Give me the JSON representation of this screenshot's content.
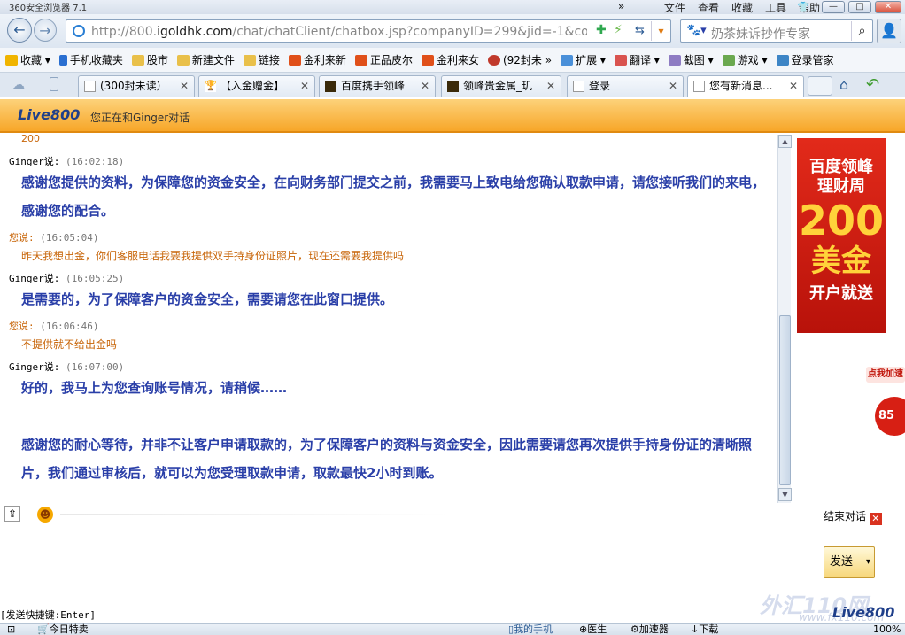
{
  "window": {
    "title": "360安全浏览器 7.1",
    "menu": [
      "文件",
      "查看",
      "收藏",
      "工具",
      "帮助"
    ],
    "controls": {
      "more": "»",
      "minimize": "—",
      "maximize": "□",
      "close": "✕"
    }
  },
  "nav": {
    "url_host": "http://800.",
    "url_domain": "igoldhk.com",
    "url_path": "/chat/chatClient/chatbox.jsp?companyID=299&jid=-1&configID",
    "search_placeholder": "奶茶妹诉抄作专家"
  },
  "favorites": [
    {
      "label": "收藏",
      "icon": "star-icon",
      "color": "#f0b400"
    },
    {
      "label": "手机收藏夹",
      "icon": "phone-icon",
      "color": "#2a6fd1"
    },
    {
      "label": "股市",
      "icon": "folder-icon",
      "color": "#e9c04a"
    },
    {
      "label": "新建文件",
      "icon": "folder-icon",
      "color": "#e9c04a"
    },
    {
      "label": "链接",
      "icon": "folder-icon",
      "color": "#e9c04a"
    },
    {
      "label": "金利来新",
      "icon": "taobao-icon",
      "color": "#e0501a"
    },
    {
      "label": "正品皮尔",
      "icon": "taobao-icon",
      "color": "#e0501a"
    },
    {
      "label": "金利来女",
      "icon": "taobao-icon",
      "color": "#e0501a"
    },
    {
      "label": "(92封未",
      "icon": "shop-icon",
      "color": "#c0392b"
    },
    {
      "label": "扩展",
      "icon": "extension-icon",
      "color": "#4a90d9"
    },
    {
      "label": "翻译",
      "icon": "translate-icon",
      "color": "#d9534f"
    },
    {
      "label": "截图",
      "icon": "screenshot-icon",
      "color": "#8e7cc3"
    },
    {
      "label": "游戏",
      "icon": "game-icon",
      "color": "#6aa84f"
    },
    {
      "label": "登录管家",
      "icon": "key-icon",
      "color": "#3d85c6"
    }
  ],
  "tabs": [
    {
      "label": "(300封未读）",
      "active": false
    },
    {
      "label": "【入金赠金】",
      "active": false
    },
    {
      "label": "百度携手领峰",
      "active": false
    },
    {
      "label": "领峰贵金属_玑",
      "active": false
    },
    {
      "label": "登录",
      "active": false
    },
    {
      "label": "您有新消息...",
      "active": true
    }
  ],
  "live800": {
    "logo": "Live800",
    "talking_with": "您正在和Ginger对话"
  },
  "chat": {
    "partial_top": "200",
    "messages": [
      {
        "speaker": "Ginger说:",
        "time": "(16:02:18)",
        "role": "agent",
        "text": "感谢您提供的资料，为保障您的资金安全，在向财务部门提交之前，我需要马上致电给您确认取款申请，请您接听我们的来电，感谢您的配合。"
      },
      {
        "speaker": "您说:",
        "time": "(16:05:04)",
        "role": "user",
        "text": "昨天我想出金，你们客服电话我要我提供双手持身份证照片，现在还需要我提供吗"
      },
      {
        "speaker": "Ginger说:",
        "time": "(16:05:25)",
        "role": "agent",
        "text": "是需要的，为了保障客户的资金安全，需要请您在此窗口提供。"
      },
      {
        "speaker": "您说:",
        "time": "(16:06:46)",
        "role": "user",
        "text": "不提供就不给出金吗"
      },
      {
        "speaker": "Ginger说:",
        "time": "(16:07:00)",
        "role": "agent",
        "text": "好的，我马上为您查询账号情况，请稍候……"
      }
    ],
    "followup": "感谢您的耐心等待，并非不让客户申请取款的，为了保障客户的资料与资金安全，因此需要请您再次提供手持身份证的清晰照片，我们通过审核后，就可以为您受理取款申请，取款最快2小时到账。"
  },
  "ad": {
    "line1": "百度领峰",
    "line2": "理财周",
    "line3": "200",
    "line4": "美金",
    "line5": "开户就送"
  },
  "speed_widget": {
    "label": "点我加速",
    "value": "85"
  },
  "controls": {
    "end_chat": "结束对话",
    "send": "发送",
    "shortcut": "[发送快捷键:Enter]"
  },
  "watermark": {
    "text": "外汇110网",
    "url": "www.fx110.com",
    "logo": "Live800"
  },
  "statusbar": {
    "left": "今日特卖",
    "items": [
      "我的手机",
      "医生",
      "加速器",
      "下载"
    ],
    "zoom": "100%"
  }
}
